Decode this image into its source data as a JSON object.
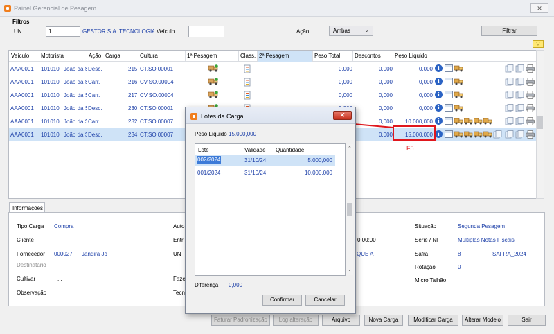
{
  "window": {
    "title": "Painel Gerencial de Pesagem",
    "close_glyph": "✕"
  },
  "filtros": {
    "section_label": "Filtros",
    "un_label": "UN",
    "un_value": "1",
    "company": "GESTOR S.A. TECNOLOGIA I",
    "veiculo_label": "Veículo",
    "veiculo_value": "",
    "acao_label": "Ação",
    "acao_value": "Ambas",
    "filtrar_label": "Filtrar"
  },
  "grid": {
    "columns": [
      "Veículo",
      "Motorista",
      "Ação",
      "Carga",
      "Cultura",
      "1ª Pesagem",
      "Class.",
      "2ª Pesagem",
      "Peso Total",
      "Descontos",
      "Peso Líquido"
    ],
    "rows": [
      {
        "veiculo": "AAA0001",
        "motorista_cod": "101010",
        "motorista_nome": "João da S",
        "acao": "Desc.",
        "carga": "215",
        "cultura": "CT.SO.00001",
        "peso_total": "0,000",
        "descontos": "0,000",
        "peso_liquido": "0,000"
      },
      {
        "veiculo": "AAA0001",
        "motorista_cod": "101010",
        "motorista_nome": "João da S",
        "acao": "Carr.",
        "carga": "216",
        "cultura": "CV.SO.00004",
        "peso_total": "0,000",
        "descontos": "0,000",
        "peso_liquido": "0,000"
      },
      {
        "veiculo": "AAA0001",
        "motorista_cod": "101010",
        "motorista_nome": "João da S",
        "acao": "Carr.",
        "carga": "217",
        "cultura": "CV.SO.00004",
        "peso_total": "0,000",
        "descontos": "0,000",
        "peso_liquido": "0,000"
      },
      {
        "veiculo": "AAA0001",
        "motorista_cod": "101010",
        "motorista_nome": "João da S",
        "acao": "Desc.",
        "carga": "230",
        "cultura": "CT.SO.00001",
        "peso_total": "0,000",
        "descontos": "0,000",
        "peso_liquido": "0,000"
      },
      {
        "veiculo": "AAA0001",
        "motorista_cod": "101010",
        "motorista_nome": "João da S",
        "acao": "Carr.",
        "carga": "232",
        "cultura": "CT.SO.00007",
        "peso_total": "0,000",
        "descontos": "0,000",
        "peso_liquido": "10.000,000"
      },
      {
        "veiculo": "AAA0001",
        "motorista_cod": "101010",
        "motorista_nome": "João da S",
        "acao": "Desc.",
        "carga": "234",
        "cultura": "CT.SO.00007",
        "peso_total": "",
        "descontos": "0,000",
        "peso_liquido": "15.000,000"
      }
    ],
    "info_glyph": "i"
  },
  "annotation": {
    "key_hint": "F5",
    "highlight_color": "#e0171d"
  },
  "informacoes": {
    "tab_label": "Informações",
    "tipo_carga_label": "Tipo Carga",
    "tipo_carga_value": "Compra",
    "cliente_label": "Cliente",
    "fornecedor_label": "Fornecedor",
    "fornecedor_cod": "000027",
    "fornecedor_nome": "Jandira Jó",
    "destinatario_label": "Destinatário",
    "cultivar_label": "Cultivar",
    "cultivar_value": ". .",
    "observacao_label": "Observação",
    "auto_label": "Auto",
    "entr_label": "Entr",
    "un_label": "UN",
    "faze_label": "Faze",
    "tecn_label": "Tecn",
    "time_partial": "0:00:00",
    "que_partial": "QUE A",
    "situacao_label": "Situação",
    "situacao_value": "Segunda Pesagem",
    "serie_label": "Série / NF",
    "serie_value": "Múltiplas Notas Fiscais",
    "safra_label": "Safra",
    "safra_num": "8",
    "safra_value": "SAFRA_2024",
    "rotacao_label": "Rotação",
    "rotacao_value": "0",
    "micro_label": "Micro Talhão"
  },
  "bottom_buttons": {
    "faturar": "Faturar Padronização",
    "log": "Log alteração",
    "arquivo": "Arquivo",
    "nova_carga": "Nova Carga",
    "modificar": "Modificar Carga",
    "alterar": "Alterar Modelo",
    "sair": "Sair"
  },
  "dialog": {
    "title": "Lotes da Carga",
    "close_glyph": "✕",
    "peso_label": "Peso Líquido",
    "peso_value": "15.000,000",
    "columns": [
      "Lote",
      "Validade",
      "Quantidade"
    ],
    "rows": [
      {
        "lote": "002/2024",
        "validade": "31/10/24",
        "quantidade": "5.000,000"
      },
      {
        "lote": "001/2024",
        "validade": "31/10/24",
        "quantidade": "10.000,000"
      }
    ],
    "diferenca_label": "Diferença",
    "diferenca_value": "0,000",
    "confirmar": "Confirmar",
    "cancelar": "Cancelar"
  }
}
